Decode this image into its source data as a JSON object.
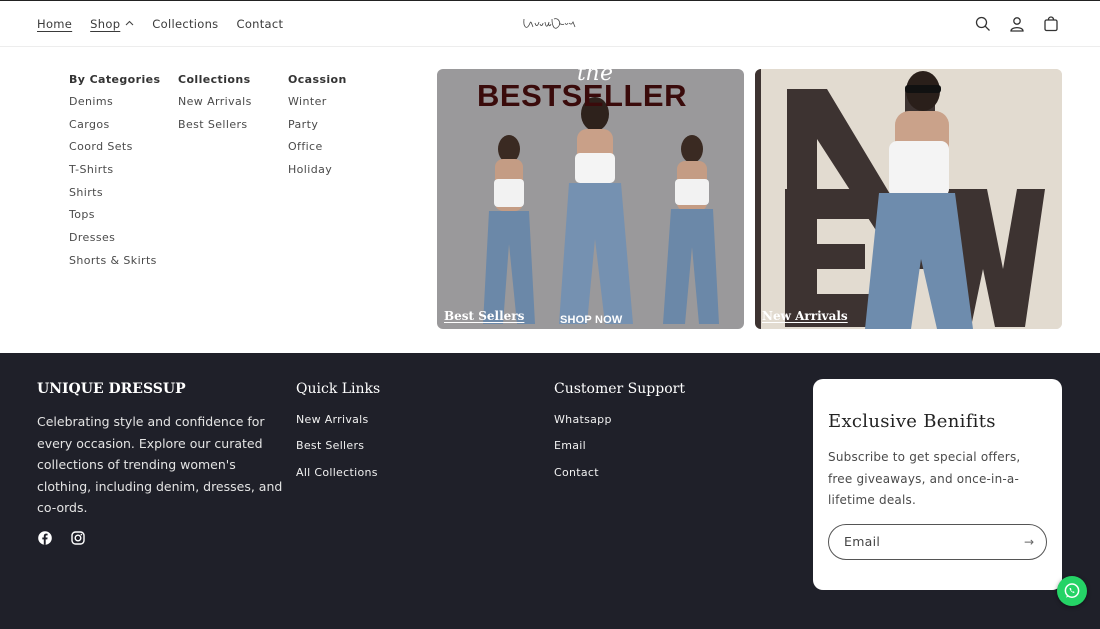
{
  "header": {
    "nav": {
      "home": "Home",
      "shop": "Shop",
      "collections": "Collections",
      "contact": "Contact"
    },
    "logo_text": "Unique Dressup",
    "icons": [
      "search-icon",
      "account-icon",
      "cart-icon"
    ]
  },
  "mega_menu": {
    "categories": {
      "heading": "By Categories",
      "items": [
        "Denims",
        "Cargos",
        "Coord Sets",
        "T-Shirts",
        "Shirts",
        "Tops",
        "Dresses",
        "Shorts & Skirts"
      ]
    },
    "collections": {
      "heading": "Collections",
      "items": [
        "New Arrivals",
        "Best Sellers"
      ]
    },
    "occasion": {
      "heading": "Ocassion",
      "items": [
        "Winter",
        "Party",
        "Office",
        "Holiday"
      ]
    },
    "promos": {
      "bestsellers": {
        "script": "the",
        "banner": "BESTSELLER",
        "shop_now": "SHOP NOW",
        "label": "Best Sellers"
      },
      "new_arrivals": {
        "label": "New Arrivals"
      }
    }
  },
  "footer": {
    "brand": {
      "title": "UNIQUE DRESSUP",
      "about": "Celebrating style and confidence for every occasion. Explore our curated collections of trending women's clothing, including denim, dresses, and co-ords."
    },
    "quick_links": {
      "title": "Quick Links",
      "items": [
        "New Arrivals",
        "Best Sellers",
        "All Collections"
      ]
    },
    "support": {
      "title": "Customer Support",
      "items": [
        "Whatsapp",
        "Email",
        "Contact"
      ]
    },
    "newsletter": {
      "title": "Exclusive Benifits",
      "text": "Subscribe to get special offers, free giveaways, and once-in-a-lifetime deals.",
      "placeholder": "Email",
      "submit": "→"
    }
  },
  "colors": {
    "footer_bg": "#1f2029",
    "bestseller_text": "#3a0b0b",
    "whatsapp": "#25d366"
  }
}
